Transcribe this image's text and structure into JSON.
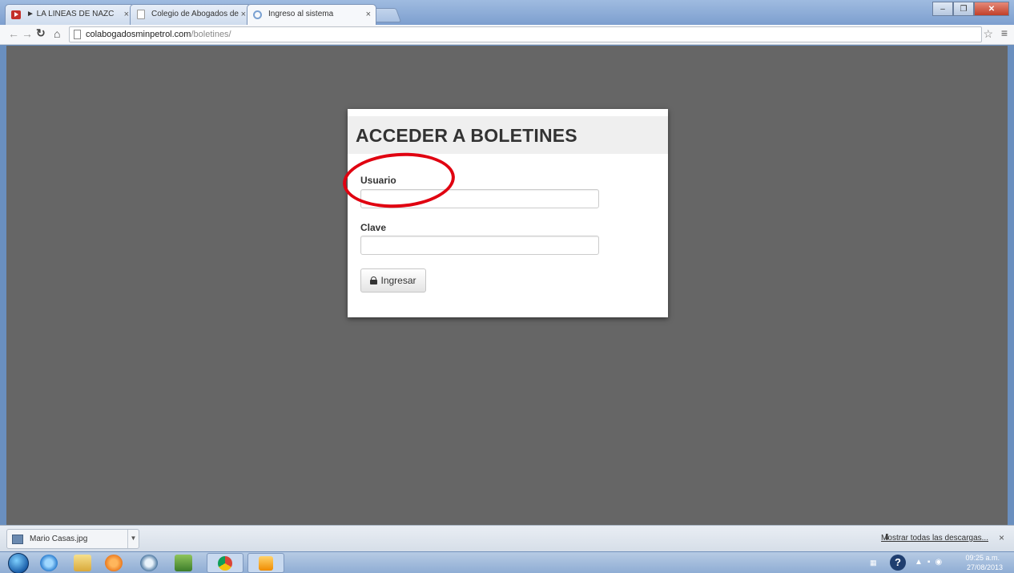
{
  "browser": {
    "tabs": [
      {
        "label": "► LA LINEAS DE NAZC",
        "icon": "youtube-icon"
      },
      {
        "label": "Colegio de Abogados de",
        "icon": "page-icon"
      },
      {
        "label": "Ingreso al sistema",
        "icon": "loading-icon"
      }
    ],
    "tab_close_glyph": "×",
    "url_host": "colabogadosminpetrol.com",
    "url_path": "/boletines/"
  },
  "login": {
    "title": "ACCEDER A BOLETINES",
    "usuario_label": "Usuario",
    "usuario_value": "",
    "clave_label": "Clave",
    "clave_value": "",
    "submit_label": "Ingresar"
  },
  "annotation": {
    "color": "#e00010"
  },
  "downloads": {
    "file_name": "Mario Casas.jpg",
    "show_all_label": "Mostrar todas las descargas...",
    "close_glyph": "×"
  },
  "taskbar": {
    "time": "09:25 a.m.",
    "date": "27/08/2013"
  },
  "colors": {
    "viewport_bg": "#666666",
    "card_header_bg": "#efefef"
  }
}
